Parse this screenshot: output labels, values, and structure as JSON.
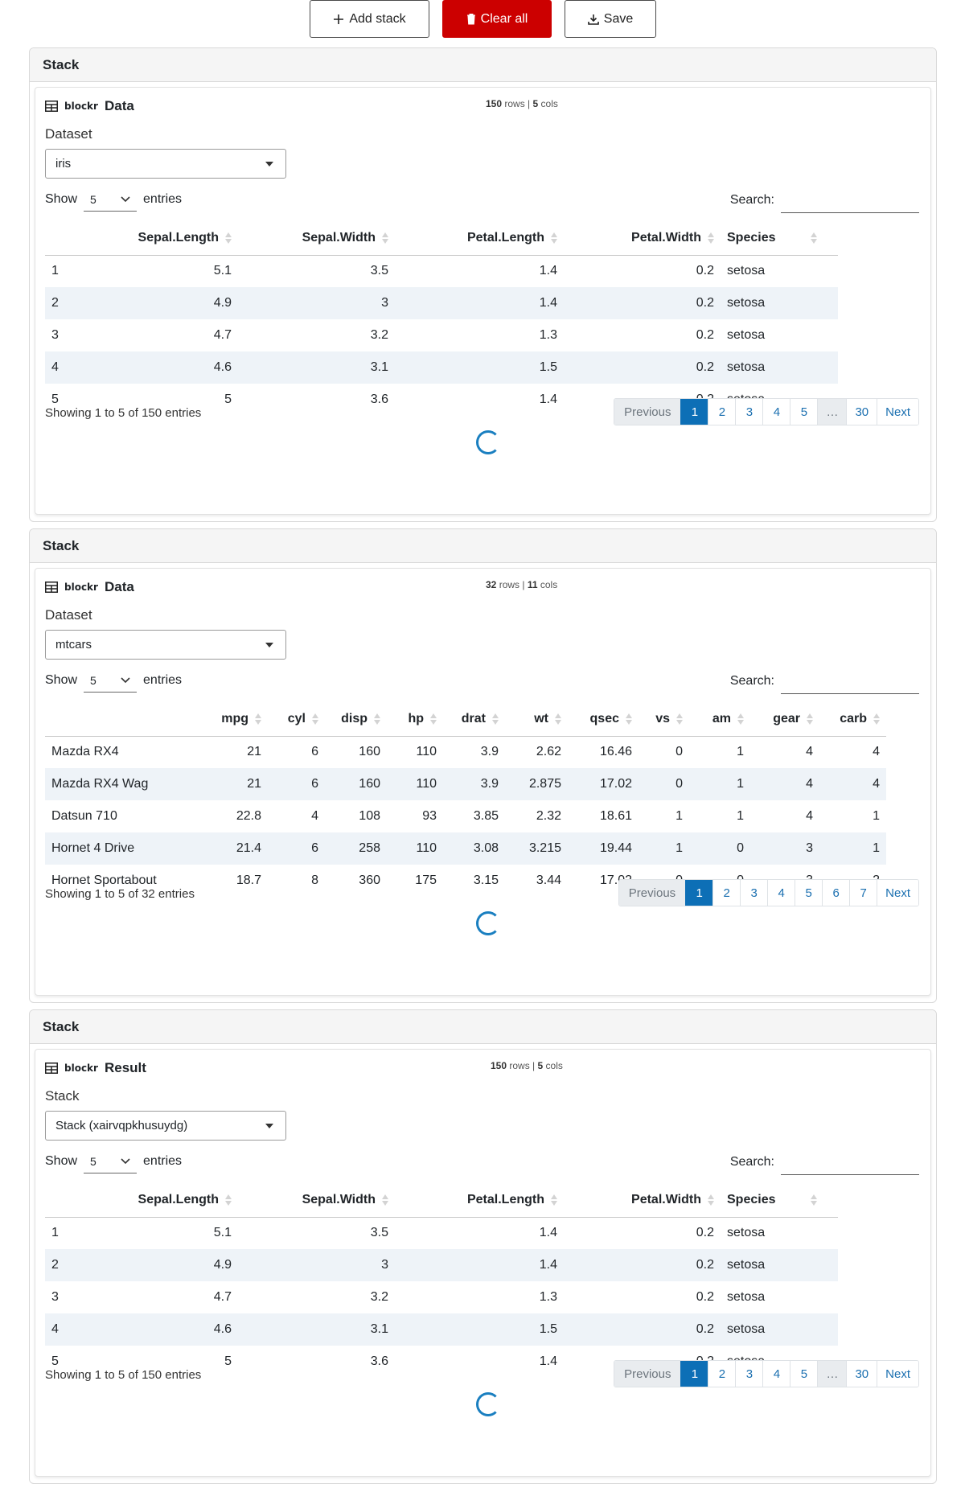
{
  "toolbar": {
    "add_stack": "Add stack",
    "clear_all": "Clear all",
    "save": "Save"
  },
  "stacks": [
    {
      "header": "Stack",
      "block": {
        "pkg": "blockr",
        "title": "Data",
        "rows": "150",
        "rows_word": "rows",
        "cols": "5",
        "cols_word": "cols",
        "field_label": "Dataset",
        "select_value": "iris"
      },
      "table": {
        "show_label": "Show",
        "length_value": "5",
        "entries_label": "entries",
        "search_label": "Search:",
        "columns": [
          "",
          "Sepal.Length",
          "Sepal.Width",
          "Petal.Length",
          "Petal.Width",
          "Species"
        ],
        "rows": [
          [
            "1",
            "5.1",
            "3.5",
            "1.4",
            "0.2",
            "setosa"
          ],
          [
            "2",
            "4.9",
            "3",
            "1.4",
            "0.2",
            "setosa"
          ],
          [
            "3",
            "4.7",
            "3.2",
            "1.3",
            "0.2",
            "setosa"
          ],
          [
            "4",
            "4.6",
            "3.1",
            "1.5",
            "0.2",
            "setosa"
          ],
          [
            "5",
            "5",
            "3.6",
            "1.4",
            "0.2",
            "setosa"
          ]
        ],
        "info": "Showing 1 to 5 of 150 entries",
        "pages": [
          "Previous",
          "1",
          "2",
          "3",
          "4",
          "5",
          "…",
          "30",
          "Next"
        ]
      }
    },
    {
      "header": "Stack",
      "block": {
        "pkg": "blockr",
        "title": "Data",
        "rows": "32",
        "rows_word": "rows",
        "cols": "11",
        "cols_word": "cols",
        "field_label": "Dataset",
        "select_value": "mtcars"
      },
      "table": {
        "show_label": "Show",
        "length_value": "5",
        "entries_label": "entries",
        "search_label": "Search:",
        "columns": [
          "",
          "mpg",
          "cyl",
          "disp",
          "hp",
          "drat",
          "wt",
          "qsec",
          "vs",
          "am",
          "gear",
          "carb"
        ],
        "rows": [
          [
            "Mazda RX4",
            "21",
            "6",
            "160",
            "110",
            "3.9",
            "2.62",
            "16.46",
            "0",
            "1",
            "4",
            "4"
          ],
          [
            "Mazda RX4 Wag",
            "21",
            "6",
            "160",
            "110",
            "3.9",
            "2.875",
            "17.02",
            "0",
            "1",
            "4",
            "4"
          ],
          [
            "Datsun 710",
            "22.8",
            "4",
            "108",
            "93",
            "3.85",
            "2.32",
            "18.61",
            "1",
            "1",
            "4",
            "1"
          ],
          [
            "Hornet 4 Drive",
            "21.4",
            "6",
            "258",
            "110",
            "3.08",
            "3.215",
            "19.44",
            "1",
            "0",
            "3",
            "1"
          ],
          [
            "Hornet Sportabout",
            "18.7",
            "8",
            "360",
            "175",
            "3.15",
            "3.44",
            "17.02",
            "0",
            "0",
            "3",
            "2"
          ]
        ],
        "info": "Showing 1 to 5 of 32 entries",
        "pages": [
          "Previous",
          "1",
          "2",
          "3",
          "4",
          "5",
          "6",
          "7",
          "Next"
        ]
      }
    },
    {
      "header": "Stack",
      "block": {
        "pkg": "blockr",
        "title": "Result",
        "rows": "150",
        "rows_word": "rows",
        "cols": "5",
        "cols_word": "cols",
        "field_label": "Stack",
        "select_value": "Stack (xairvqpkhusuydg)"
      },
      "table": {
        "show_label": "Show",
        "length_value": "5",
        "entries_label": "entries",
        "search_label": "Search:",
        "columns": [
          "",
          "Sepal.Length",
          "Sepal.Width",
          "Petal.Length",
          "Petal.Width",
          "Species"
        ],
        "rows": [
          [
            "1",
            "5.1",
            "3.5",
            "1.4",
            "0.2",
            "setosa"
          ],
          [
            "2",
            "4.9",
            "3",
            "1.4",
            "0.2",
            "setosa"
          ],
          [
            "3",
            "4.7",
            "3.2",
            "1.3",
            "0.2",
            "setosa"
          ],
          [
            "4",
            "4.6",
            "3.1",
            "1.5",
            "0.2",
            "setosa"
          ],
          [
            "5",
            "5",
            "3.6",
            "1.4",
            "0.2",
            "setosa"
          ]
        ],
        "info": "Showing 1 to 5 of 150 entries",
        "pages": [
          "Previous",
          "1",
          "2",
          "3",
          "4",
          "5",
          "…",
          "30",
          "Next"
        ]
      }
    }
  ]
}
